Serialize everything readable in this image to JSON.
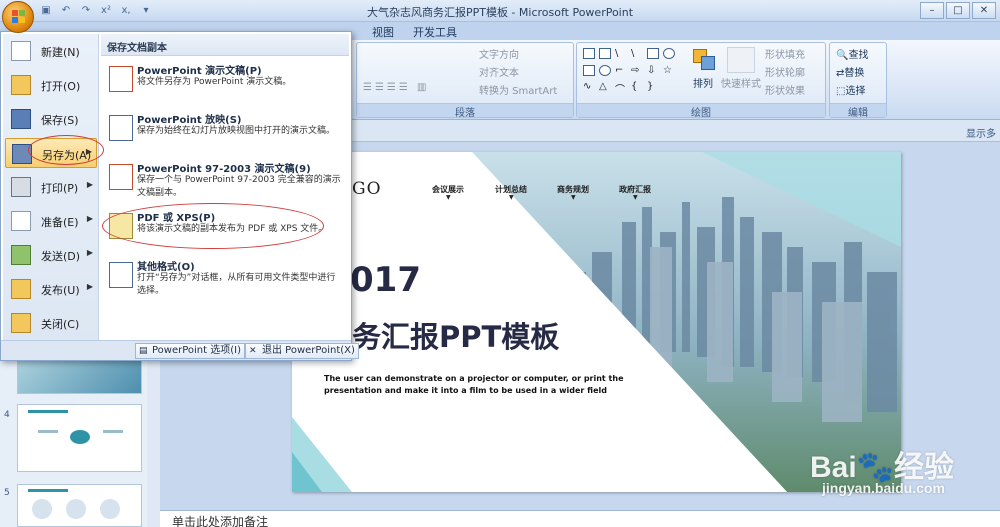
{
  "window": {
    "title": "大气杂志风商务汇报PPT模板 - Microsoft PowerPoint",
    "controls": [
      "–",
      "□",
      "✕"
    ]
  },
  "qat": {
    "items": [
      "save-icon",
      "undo-icon",
      "redo-icon",
      "superscript-icon",
      "subscript-icon",
      "dropdown-icon"
    ],
    "superscript": "x²",
    "subscript": "x,"
  },
  "tabs": [
    "视图",
    "开发工具"
  ],
  "ribbon": {
    "paragraph": {
      "label": "段落",
      "text_direction": "文字方向",
      "align_text": "对齐文本",
      "smartart": "转换为 SmartArt"
    },
    "drawing": {
      "label": "绘图",
      "arrange": "排列",
      "quick_styles": "快速样式",
      "shape_fill": "形状填充",
      "shape_outline": "形状轮廓",
      "shape_effects": "形状效果"
    },
    "editing": {
      "label": "编辑",
      "find": "查找",
      "replace": "替换",
      "select": "选择"
    },
    "show_more": "显示多"
  },
  "office_menu": {
    "left_items": [
      {
        "label": "新建(N)",
        "icon": "new-icon",
        "arrow": false
      },
      {
        "label": "打开(O)",
        "icon": "open-icon",
        "arrow": false
      },
      {
        "label": "保存(S)",
        "icon": "save-icon",
        "arrow": false
      },
      {
        "label": "另存为(A)",
        "icon": "save-as-icon",
        "arrow": true,
        "active": true
      },
      {
        "label": "打印(P)",
        "icon": "print-icon",
        "arrow": true
      },
      {
        "label": "准备(E)",
        "icon": "prepare-icon",
        "arrow": true
      },
      {
        "label": "发送(D)",
        "icon": "send-icon",
        "arrow": true
      },
      {
        "label": "发布(U)",
        "icon": "publish-icon",
        "arrow": true
      },
      {
        "label": "关闭(C)",
        "icon": "close-folder-icon",
        "arrow": false
      }
    ],
    "right_header": "保存文档副本",
    "options": [
      {
        "title": "PowerPoint 演示文稿(P)",
        "desc": "将文件另存为 PowerPoint 演示文稿。",
        "icon": "pptx-icon"
      },
      {
        "title": "PowerPoint 放映(S)",
        "desc": "保存为始终在幻灯片放映视图中打开的演示文稿。",
        "icon": "ppsx-icon"
      },
      {
        "title": "PowerPoint 97-2003 演示文稿(9)",
        "desc": "保存一个与 PowerPoint 97-2003 完全兼容的演示文稿副本。",
        "icon": "ppt-icon"
      },
      {
        "title": "PDF 或 XPS(P)",
        "desc": "将该演示文稿的副本发布为 PDF 或 XPS 文件。",
        "icon": "pdf-xps-icon"
      },
      {
        "title": "其他格式(O)",
        "desc": "打开“另存为”对话框，从所有可用文件类型中进行选择。",
        "icon": "other-formats-icon"
      }
    ],
    "options_button": "PowerPoint 选项(I)",
    "exit_button": "退出 PowerPoint(X)"
  },
  "slides_pane": {
    "slide_numbers": [
      "4",
      "5"
    ]
  },
  "slide": {
    "logo": "GO",
    "nav": [
      "会议展示",
      "计划总结",
      "商务规划",
      "政府汇报"
    ],
    "year": "017",
    "headline": "务汇报PPT模板",
    "desc": "The user can demonstrate on a projector or computer, or print the presentation and make it into a film to be used in a wider field"
  },
  "notes": {
    "placeholder": "单击此处添加备注"
  },
  "watermark": {
    "brand": "Bai🐾经验",
    "url": "jingyan.baidu.com"
  },
  "colors": {
    "accent": "#f8cf6e",
    "ribbon": "#dce8f6",
    "annotation": "#d23c3c",
    "teal": "#6fc4cf"
  }
}
